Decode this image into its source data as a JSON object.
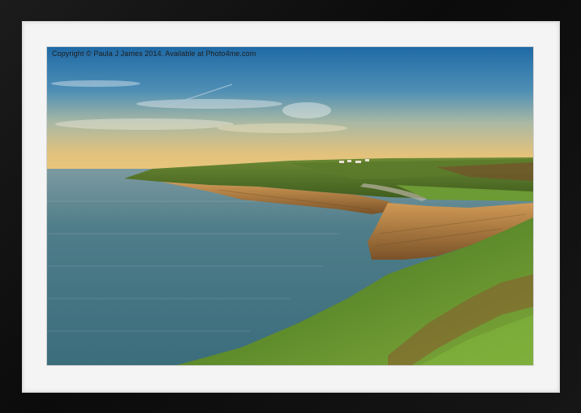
{
  "photo": {
    "watermark": "Copyright © Paula J James 2014. Available at Photo4me.com"
  },
  "colors": {
    "frame": "#111111",
    "mat": "#f4f4f4",
    "sky_top": "#1f6fa8",
    "sky_horizon": "#e8c47a",
    "sea": "#4f7f8c",
    "cliff": "#b5803e",
    "grass": "#5f8a2c"
  }
}
